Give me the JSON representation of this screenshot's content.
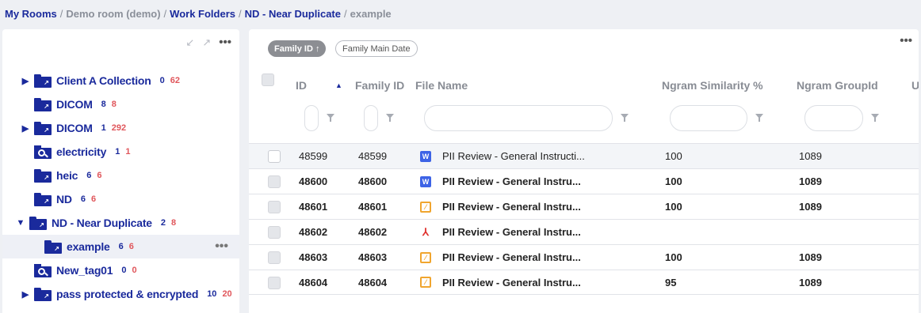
{
  "breadcrumb": {
    "my_rooms": "My Rooms",
    "demo_room": "Demo room (demo)",
    "work_folders": "Work Folders",
    "nd": "ND - Near Duplicate",
    "current": "example",
    "separator": "/"
  },
  "sidebar": {
    "more_label": "•••",
    "items": [
      {
        "label": "Client A Collection",
        "count_a": "0",
        "count_b": "62",
        "caret": "▶",
        "icon": "folder-icon"
      },
      {
        "label": "DICOM",
        "count_a": "8",
        "count_b": "8",
        "caret": "",
        "icon": "folder-icon"
      },
      {
        "label": "DICOM",
        "count_a": "1",
        "count_b": "292",
        "caret": "▶",
        "icon": "folder-icon"
      },
      {
        "label": "electricity",
        "count_a": "1",
        "count_b": "1",
        "caret": "",
        "icon": "search-folder-icon"
      },
      {
        "label": "heic",
        "count_a": "6",
        "count_b": "6",
        "caret": "",
        "icon": "folder-icon"
      },
      {
        "label": "ND",
        "count_a": "6",
        "count_b": "6",
        "caret": "",
        "icon": "folder-icon"
      },
      {
        "label": "ND - Near Duplicate",
        "count_a": "2",
        "count_b": "8",
        "caret": "▼",
        "icon": "folder-icon"
      },
      {
        "label": "example",
        "count_a": "6",
        "count_b": "6",
        "caret": "",
        "icon": "folder-icon"
      },
      {
        "label": "New_tag01",
        "count_a": "0",
        "count_b": "0",
        "caret": "",
        "icon": "search-folder-icon"
      },
      {
        "label": "pass protected & encrypted",
        "count_a": "10",
        "count_b": "20",
        "caret": "▶",
        "icon": "folder-icon"
      }
    ]
  },
  "main": {
    "more_label": "•••",
    "sort_chips": {
      "active": "Family ID ↑",
      "inactive": "Family Main Date"
    },
    "columns": [
      "ID",
      "Family ID",
      "File Name",
      "Ngram Similarity %",
      "Ngram GroupId",
      "U"
    ],
    "rows": [
      {
        "id": "48599",
        "family_id": "48599",
        "file_name": "PII Review - General Instructi...",
        "similarity": "100",
        "group_id": "1089",
        "file_icon": "word-icon"
      },
      {
        "id": "48600",
        "family_id": "48600",
        "file_name": "PII Review - General Instru...",
        "similarity": "100",
        "group_id": "1089",
        "file_icon": "word-icon"
      },
      {
        "id": "48601",
        "family_id": "48601",
        "file_name": "PII Review - General Instru...",
        "similarity": "100",
        "group_id": "1089",
        "file_icon": "pages-icon"
      },
      {
        "id": "48602",
        "family_id": "48602",
        "file_name": "PII Review - General Instru...",
        "similarity": "",
        "group_id": "",
        "file_icon": "pdf-icon"
      },
      {
        "id": "48603",
        "family_id": "48603",
        "file_name": "PII Review - General Instru...",
        "similarity": "100",
        "group_id": "1089",
        "file_icon": "pages-icon"
      },
      {
        "id": "48604",
        "family_id": "48604",
        "file_name": "PII Review - General Instru...",
        "similarity": "95",
        "group_id": "1089",
        "file_icon": "pages-icon"
      }
    ]
  },
  "colors": {
    "brand": "#1a2a9c",
    "count_red": "#e0565b",
    "background": "#eef0f4"
  }
}
